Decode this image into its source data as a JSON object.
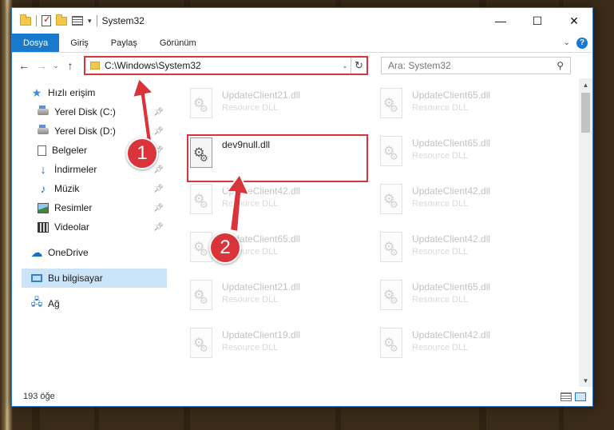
{
  "window": {
    "title": "System32",
    "controls": {
      "minimize": "—",
      "maximize": "☐",
      "close": "✕"
    }
  },
  "ribbon": {
    "tabs": [
      "Dosya",
      "Giriş",
      "Paylaş",
      "Görünüm"
    ],
    "help": "?"
  },
  "address": {
    "path": "C:\\Windows\\System32",
    "search_placeholder": "Ara: System32"
  },
  "sidebar": {
    "items": [
      {
        "label": "Hızlı erişim",
        "icon": "star-icon"
      },
      {
        "label": "Yerel Disk (C:)",
        "icon": "disk-icon",
        "pinned": true
      },
      {
        "label": "Yerel Disk (D:)",
        "icon": "disk-icon",
        "pinned": true
      },
      {
        "label": "Belgeler",
        "icon": "documents-icon",
        "pinned": true
      },
      {
        "label": "İndirmeler",
        "icon": "download-icon",
        "pinned": true
      },
      {
        "label": "Müzik",
        "icon": "music-icon",
        "pinned": true
      },
      {
        "label": "Resimler",
        "icon": "pictures-icon",
        "pinned": true
      },
      {
        "label": "Videolar",
        "icon": "videos-icon",
        "pinned": true
      },
      {
        "label": "OneDrive",
        "icon": "cloud-icon"
      },
      {
        "label": "Bu bilgisayar",
        "icon": "computer-icon",
        "selected": true
      },
      {
        "label": "Ağ",
        "icon": "network-icon"
      }
    ]
  },
  "files": {
    "left_column": [
      {
        "name": "UpdateClient21.dll",
        "type": "Resource DLL"
      },
      {
        "name": "dev9null.dll",
        "type": "",
        "active": true
      },
      {
        "name": "UpdateClient42.dll",
        "type": "Resource DLL"
      },
      {
        "name": "UpdateClient65.dll",
        "type": "Resource DLL"
      },
      {
        "name": "UpdateClient21.dll",
        "type": "Resource DLL"
      },
      {
        "name": "UpdateClient19.dll",
        "type": "Resource DLL"
      }
    ],
    "right_column": [
      {
        "name": "UpdateClient65.dll",
        "type": "Resource DLL"
      },
      {
        "name": "UpdateClient65.dll",
        "type": "Resource DLL"
      },
      {
        "name": "UpdateClient42.dll",
        "type": "Resource DLL"
      },
      {
        "name": "UpdateClient42.dll",
        "type": "Resource DLL"
      },
      {
        "name": "UpdateClient65.dll",
        "type": "Resource DLL"
      },
      {
        "name": "UpdateClient42.dll",
        "type": "Resource DLL"
      }
    ]
  },
  "status": {
    "count": "193 öğe"
  },
  "annotations": {
    "step1": "1",
    "step2": "2",
    "accent": "#d9343a"
  }
}
